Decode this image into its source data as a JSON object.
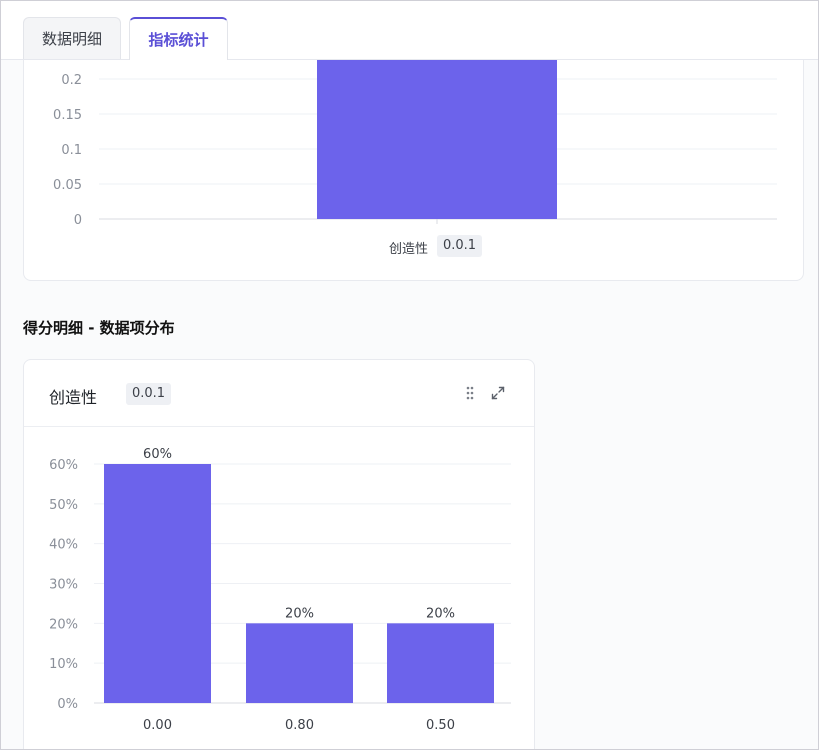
{
  "tabs": [
    {
      "label": "数据明细",
      "active": false
    },
    {
      "label": "指标统计",
      "active": true
    }
  ],
  "top_chart": {
    "category_label": "创造性",
    "badge": "0.0.1"
  },
  "section": {
    "title": "得分明细 - 数据项分布"
  },
  "dist_card": {
    "title": "创造性",
    "badge": "0.0.1",
    "drag_icon": "drag-handle-icon",
    "expand_icon": "expand-icon"
  },
  "colors": {
    "bar": "#6c63eb",
    "accent": "#5a4fd6",
    "grid": "#eef0f4",
    "axis_text": "#8a8f99"
  },
  "chart_data": [
    {
      "type": "bar",
      "categories": [
        "创造性 0.0.1"
      ],
      "values": [
        0.25
      ],
      "title": "",
      "xlabel": "",
      "ylabel": "",
      "yticks": [
        0,
        0.05,
        0.1,
        0.15,
        0.2
      ],
      "ylim": [
        0,
        0.22
      ],
      "grid": true
    },
    {
      "type": "bar",
      "categories": [
        "0.00",
        "0.80",
        "0.50"
      ],
      "values": [
        60,
        20,
        20
      ],
      "value_labels": [
        "60%",
        "20%",
        "20%"
      ],
      "title": "",
      "xlabel": "",
      "ylabel": "",
      "yticks": [
        "0%",
        "10%",
        "20%",
        "30%",
        "40%",
        "50%",
        "60%"
      ],
      "ylim": [
        0,
        60
      ],
      "grid": true
    }
  ]
}
